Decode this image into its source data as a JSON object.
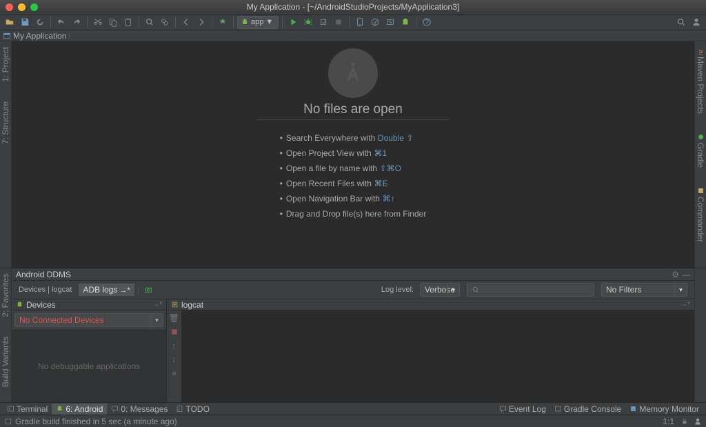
{
  "titlebar": {
    "title": "My Application - [~/AndroidStudioProjects/MyApplication3]"
  },
  "run_config": {
    "label": "app"
  },
  "breadcrumb": {
    "project": "My Application"
  },
  "left_tabs": {
    "project": "1: Project",
    "structure": "7: Structure",
    "favorites": "2: Favorites",
    "build_variants": "Build Variants"
  },
  "right_tabs": {
    "maven": "Maven Projects",
    "gradle": "Gradle",
    "commander": "Commander"
  },
  "editor": {
    "title": "No files are open",
    "hints": [
      {
        "text": "Search Everywhere with",
        "shortcut": "Double ⇧"
      },
      {
        "text": "Open Project View with",
        "shortcut": "⌘1"
      },
      {
        "text": "Open a file by name with",
        "shortcut": "⇧⌘O"
      },
      {
        "text": "Open Recent Files with",
        "shortcut": "⌘E"
      },
      {
        "text": "Open Navigation Bar with",
        "shortcut": "⌘↑"
      },
      {
        "text": "Drag and Drop file(s) here from Finder",
        "shortcut": ""
      }
    ]
  },
  "bottom_panel": {
    "header": "Android DDMS",
    "tabs": {
      "devices_logcat": "Devices | logcat",
      "adb_logs": "ADB logs"
    },
    "log_level_label": "Log level:",
    "log_level_value": "Verbose",
    "filter_value": "No Filters",
    "devices": {
      "header": "Devices",
      "dropdown_value": "No Connected Devices",
      "empty": "No debuggable applications"
    },
    "logcat": {
      "header": "logcat"
    }
  },
  "tool_windows": {
    "terminal": "Terminal",
    "android": "6: Android",
    "messages": "0: Messages",
    "todo": "TODO",
    "event_log": "Event Log",
    "gradle_console": "Gradle Console",
    "memory_monitor": "Memory Monitor"
  },
  "statusbar": {
    "message": "Gradle build finished in 5 sec (a minute ago)",
    "position": "1:1"
  }
}
